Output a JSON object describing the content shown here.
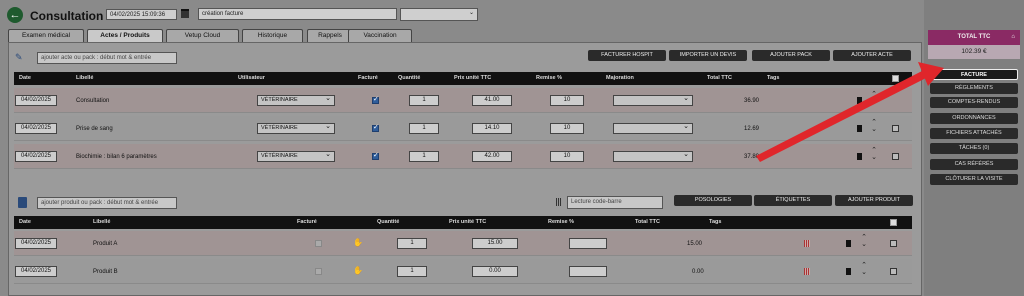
{
  "header": {
    "title": "Consultation",
    "datetime": "04/02/2025 15:09:36",
    "description": "création facture",
    "select_value": ""
  },
  "tabs": [
    {
      "label": "Examen médical"
    },
    {
      "label": "Actes / Produits"
    },
    {
      "label": "Vetup Cloud"
    },
    {
      "label": "Historique"
    },
    {
      "label": "Rappels"
    },
    {
      "label": "Vaccination"
    }
  ],
  "actes": {
    "search_placeholder": "ajouter acte ou pack : début mot & entrée",
    "buttons": [
      "FACTURER HOSPIT",
      "IMPORTER UN DEVIS",
      "AJOUTER PACK",
      "AJOUTER ACTE"
    ],
    "columns": [
      "Date",
      "Libellé",
      "Utilisateur",
      "Facturé",
      "Quantité",
      "Prix unité TTC",
      "Remise %",
      "Majoration",
      "Total TTC",
      "Tags"
    ],
    "rows": [
      {
        "date": "04/02/2025",
        "label": "Consultation",
        "user": "VÉTÉRINAIRE",
        "qty": "1",
        "price": "41.00",
        "remise": "10",
        "majoration": "",
        "total": "36.90"
      },
      {
        "date": "04/02/2025",
        "label": "Prise de sang",
        "user": "VÉTÉRINAIRE",
        "qty": "1",
        "price": "14.10",
        "remise": "10",
        "majoration": "",
        "total": "12.69"
      },
      {
        "date": "04/02/2025",
        "label": "Biochimie : bilan 6 paramètres",
        "user": "VÉTÉRINAIRE",
        "qty": "1",
        "price": "42.00",
        "remise": "10",
        "majoration": "",
        "total": "37.80"
      }
    ]
  },
  "produits": {
    "search_placeholder": "ajouter produit ou pack : début mot & entrée",
    "barcode_placeholder": "Lecture code-barre",
    "buttons": [
      "POSOLOGIES",
      "ÉTIQUETTES",
      "AJOUTER PRODUIT"
    ],
    "columns": [
      "Date",
      "Libellé",
      "Facturé",
      "Quantité",
      "Prix unité TTC",
      "Remise %",
      "Total TTC",
      "Tags"
    ],
    "rows": [
      {
        "date": "04/02/2025",
        "label": "Produit A",
        "qty": "1",
        "price": "15.00",
        "remise": "",
        "total": "15.00"
      },
      {
        "date": "04/02/2025",
        "label": "Produit B",
        "qty": "1",
        "price": "0.00",
        "remise": "",
        "total": "0.00"
      }
    ]
  },
  "sidebar": {
    "total_label": "TOTAL TTC",
    "total_value": "102.39 €",
    "items": [
      "FACTURE",
      "RÈGLEMENTS",
      "COMPTES-RENDUS",
      "ORDONNANCES",
      "FICHIERS ATTACHÉS",
      "TÂCHES (0)",
      "CAS RÉFÉRÉS",
      "CLÔTURER LA VISITE"
    ]
  },
  "colors": {
    "accent": "#8a2a64",
    "arrow": "#e0262b",
    "back": "#1e5a2e"
  }
}
